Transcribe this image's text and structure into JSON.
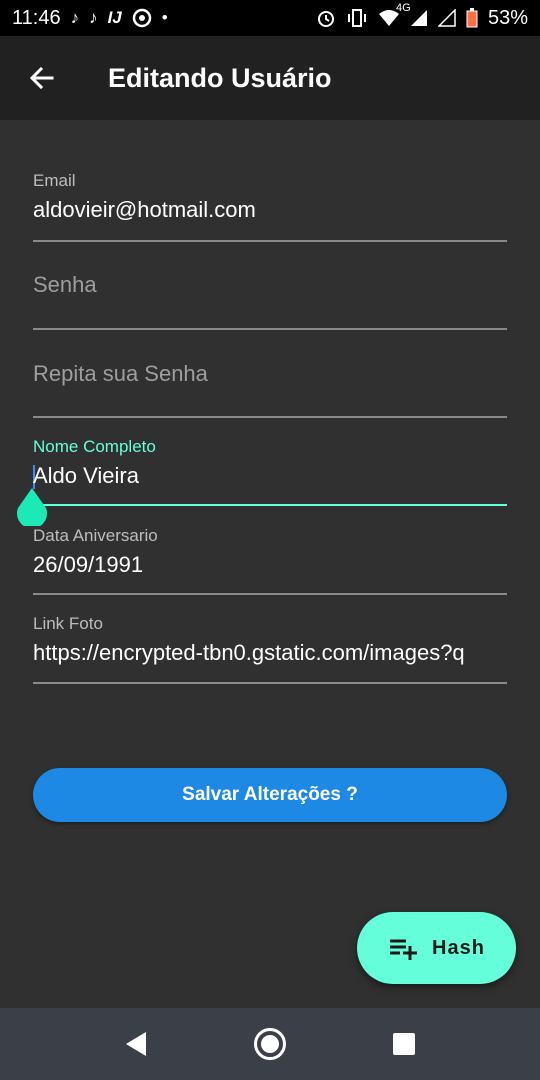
{
  "status_bar": {
    "time": "11:46",
    "network": "4G",
    "battery": "53%",
    "icons_left": [
      "tiktok-icon",
      "tiktok-icon",
      "intellij-icon",
      "chrome-icon",
      "dot-icon"
    ],
    "icons_right": [
      "alarm-icon",
      "vibrate-icon",
      "wifi-icon",
      "signal-icon",
      "signal-empty-icon",
      "battery-icon"
    ]
  },
  "app_bar": {
    "title": "Editando Usuário",
    "back_icon": "arrow-back-icon"
  },
  "form": {
    "email": {
      "label": "Email",
      "value": "aldovieir@hotmail.com"
    },
    "senha": {
      "placeholder": "Senha"
    },
    "repita_senha": {
      "placeholder": "Repita sua Senha"
    },
    "nome": {
      "label": "Nome Completo",
      "value": "Aldo Vieira"
    },
    "data": {
      "label": "Data Aniversario",
      "value": "26/09/1991"
    },
    "foto": {
      "label": "Link Foto",
      "value": "https://encrypted-tbn0.gstatic.com/images?q"
    }
  },
  "save_button": {
    "label": "Salvar Alterações ?"
  },
  "fab": {
    "label": "Hash",
    "icon": "playlist-add-icon"
  },
  "nav": [
    "back-triangle-icon",
    "home-circle-icon",
    "recents-square-icon"
  ],
  "colors": {
    "background": "#303030",
    "app_bar": "#212121",
    "accent": "#64ffda",
    "button": "#1e88e5",
    "navbar": "#3b3f47"
  }
}
